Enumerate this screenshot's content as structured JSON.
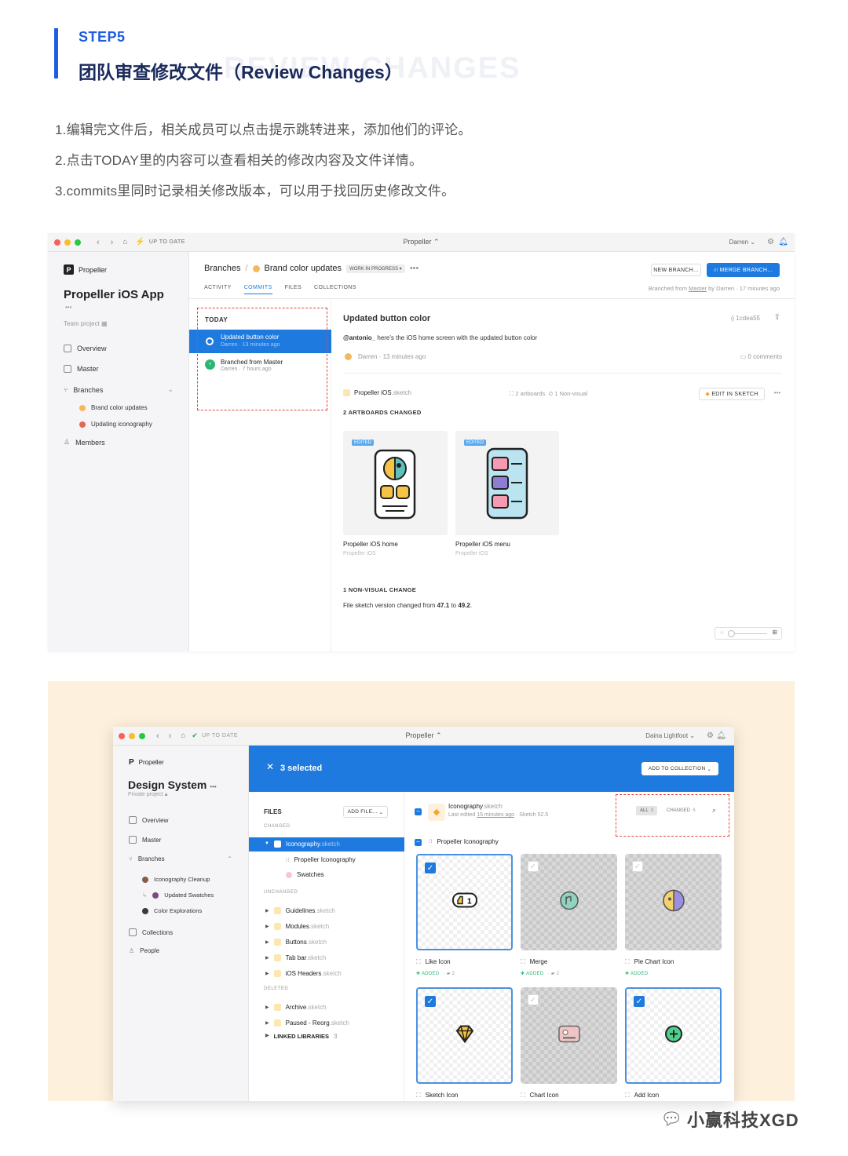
{
  "step": {
    "label": "STEP5",
    "title": "团队审查修改文件（Review Changes）",
    "ghost": "REVIEW CHANGES"
  },
  "paragraphs": [
    "1.编辑完文件后，相关成员可以点击提示跳转进来，添加他们的评论。",
    "2.点击TODAY里的内容可以查看相关的修改内容及文件详情。",
    "3.commits里同时记录相关修改版本，可以用于找回历史修改文件。"
  ],
  "w1": {
    "titlebar": {
      "status": "UP TO DATE",
      "app": "Propeller",
      "user": "Darren"
    },
    "sidebar": {
      "org": "Propeller",
      "project": "Propeller iOS App",
      "more": "•••",
      "team": "Team project",
      "items": [
        "Overview",
        "Master",
        "Branches",
        "Members"
      ],
      "branches": [
        "Brand color updates",
        "Updating iconography"
      ]
    },
    "crumb": {
      "root": "Branches",
      "sep": "/",
      "branch": "Brand color updates",
      "badge": "WORK IN PROGRESS",
      "more": "•••"
    },
    "tabs": [
      "ACTIVITY",
      "COMMITS",
      "FILES",
      "COLLECTIONS"
    ],
    "new_branch": "NEW BRANCH...",
    "merge_branch": "MERGE BRANCH...",
    "branched_info": {
      "pre": "Branched from ",
      "link": "Master",
      "post": " by Darren · 17 minutes ago"
    },
    "today": "TODAY",
    "commits": [
      {
        "title": "Updated button color",
        "meta": "Darren · 13 minutes ago"
      },
      {
        "title": "Branched from Master",
        "meta": "Darren · 7 hours ago"
      }
    ],
    "detail": {
      "title": "Updated button color",
      "hash": "1cdea55",
      "mention": "@antonio_",
      "message": " here's the iOS home screen with the updated button color",
      "author_meta": "Darren · 13 minutes ago",
      "comments": "0 comments",
      "file_name": "Propeller iOS",
      "file_ext": ".sketch",
      "artboards": "2 artboards",
      "nonvisual": "1 Non-visual",
      "edit": "EDIT IN SKETCH",
      "changed_header": "2 ARTBOARDS CHANGED",
      "cards": [
        {
          "tag": "EDITED",
          "name": "Propeller iOS home",
          "sub": "Propeller iOS"
        },
        {
          "tag": "EDITED",
          "name": "Propeller iOS menu",
          "sub": "Propeller iOS"
        }
      ],
      "nv_header": "1 NON-VISUAL CHANGE",
      "nv_pre": "File sketch version changed from ",
      "nv_from": "47.1",
      "nv_mid": " to ",
      "nv_to": "49.2",
      "nv_end": "."
    }
  },
  "w2": {
    "titlebar": {
      "status": "UP TO DATE",
      "app": "Propeller",
      "user": "Daina Lightfoot"
    },
    "sidebar": {
      "org": "Propeller",
      "project": "Design System",
      "more": "•••",
      "privacy": "Private project",
      "items": [
        "Overview",
        "Master",
        "Branches",
        "Collections",
        "People"
      ],
      "branches": [
        "Iconography Cleanup",
        "Updated Swatches",
        "Color Explorations"
      ]
    },
    "selection": "3 selected",
    "add_collection": "ADD TO COLLECTION",
    "files_header": "FILES",
    "add_file": "ADD FILE...",
    "changed": "CHANGED",
    "unchanged": "UNCHANGED",
    "deleted": "DELETED",
    "changed_files": [
      {
        "name": "Iconography",
        "ext": ".sketch"
      }
    ],
    "sub_items": [
      "Propeller Iconography",
      "Swatches"
    ],
    "unchanged_files": [
      {
        "name": "Guidelines",
        "ext": ".sketch"
      },
      {
        "name": "Modules",
        "ext": ".sketch"
      },
      {
        "name": "Buttons",
        "ext": ".sketch"
      },
      {
        "name": "Tab bar",
        "ext": ".sketch"
      },
      {
        "name": "iOS Headers",
        "ext": ".sketch"
      }
    ],
    "deleted_files": [
      {
        "name": "Archive",
        "ext": ".sketch"
      },
      {
        "name": "Paused - Reorg",
        "ext": ".sketch"
      }
    ],
    "linked": "LINKED LIBRARIES",
    "linked_count": "3",
    "file_header": {
      "name": "Iconography",
      "ext": ".sketch",
      "meta_pre": "Last edited ",
      "meta_link": "15 minutes ago",
      "meta_post": " · Sketch 52.5"
    },
    "filters": {
      "all": "ALL",
      "all_count": "9",
      "changed": "CHANGED",
      "changed_count": "6"
    },
    "page": "Propeller Iconography",
    "grid": [
      {
        "name": "Like Icon",
        "status": "ADDED",
        "comments": "2"
      },
      {
        "name": "Merge",
        "status": "ADDED",
        "comments": "2"
      },
      {
        "name": "Pie Chart Icon",
        "status": "ADDED",
        "comments": ""
      },
      {
        "name": "Sketch Icon",
        "status": "",
        "comments": ""
      },
      {
        "name": "Chart Icon",
        "status": "",
        "comments": ""
      },
      {
        "name": "Add Icon",
        "status": "",
        "comments": ""
      }
    ]
  },
  "watermark": "小赢科技XGD",
  "colors": {
    "accent": "#1f7ae0",
    "brand": "#1f5ce0",
    "highlight": "#e0453a",
    "banner": "#fdf0dc"
  }
}
